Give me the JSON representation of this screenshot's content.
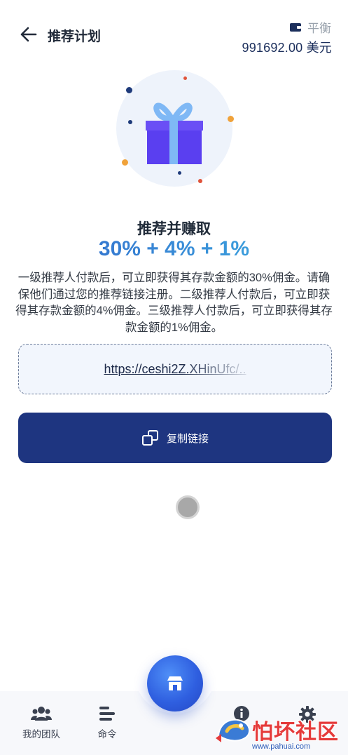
{
  "header": {
    "title": "推荐计划",
    "balance_label": "平衡",
    "balance_amount": "991692.00 美元"
  },
  "promo": {
    "title": "推荐并赚取",
    "rates": "30% + 4% + 1%",
    "description": "一级推荐人付款后，可立即获得其存款金额的30%佣金。请确保他们通过您的推荐链接注册。二级推荐人付款后，可立即获得其存款金额的4%佣金。三级推荐人付款后，可立即获得其存款金额的1%佣金。"
  },
  "referral": {
    "link": "https://ceshi2Z.XHinUfc/.."
  },
  "copy_button": {
    "label": "复制链接"
  },
  "bottom_nav": {
    "items": [
      {
        "label": "我的团队",
        "icon": "team-icon"
      },
      {
        "label": "命令",
        "icon": "orders-icon"
      },
      {
        "label": "",
        "icon": "store-icon"
      },
      {
        "label": "",
        "icon": "info-icon"
      },
      {
        "label": "",
        "icon": "gear-icon"
      }
    ]
  },
  "watermark": {
    "brand": "怕坏社区",
    "url": "www.pahuai.com"
  },
  "colors": {
    "primary": "#1e3580",
    "accent": "#3a8fd8",
    "gift": "#5a3ff0",
    "ribbon": "#7fb8f5"
  }
}
